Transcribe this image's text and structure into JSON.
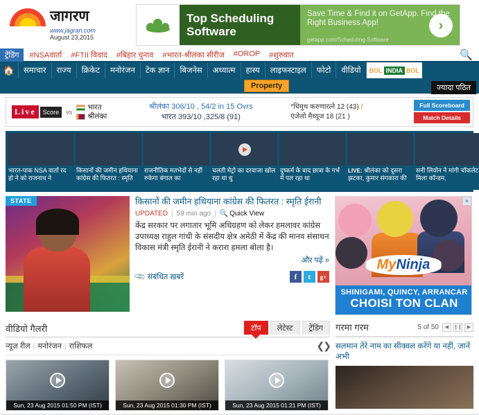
{
  "site": {
    "logo_text": "जागरण",
    "url": "www.jagran.com",
    "date": "August 23,2015"
  },
  "top_ad": {
    "headline": "Top Scheduling Software",
    "body": "Save Time & Find it on GetApp. Find the Right Business App!",
    "display_url": "getapp.com/Scheduling-Software",
    "arrow": "›"
  },
  "trending": {
    "label": "ट्रेंडिंग",
    "items": [
      "#NSAवार्ता",
      "#FTII विवाद",
      "#बिहार चुनाव",
      "#भारत-श्रीलंका सीरीज",
      "#OROP",
      "#शुरुवात"
    ],
    "search_icon": "search-icon"
  },
  "mainnav": {
    "home_icon": "home-icon",
    "items": [
      "समाचार",
      "राज्य",
      "क्रिकेट",
      "मनोरंजन",
      "टेक ज्ञान",
      "बिजनेस",
      "अध्यात्म",
      "हास्य",
      "लाइफस्टाइल",
      "फोटो",
      "वीडियो"
    ],
    "bol": {
      "left": "BOL",
      "mid": "INDIA",
      "right": "BOL"
    },
    "property_label": "Property",
    "more_read_label": "ज्यादा पठित"
  },
  "score": {
    "live_label": "Live",
    "score_label": "Score",
    "vs": "vs",
    "team1": "भारत",
    "team2": "श्रीलंका",
    "line1": "श्रीलंका 306/10 , 54/2 in 15 Ovrs",
    "line2": "भारत 393/10 ,325/8 (91)",
    "batsman1": "*धिमुथ करुणारत्ने 12 (43)",
    "batsman2": "एंजेलो मैथ्यूज 18 (21 )",
    "full_scoreboard": "Full Scoreboard",
    "match_details": "Match Details"
  },
  "thumbnails": [
    {
      "caption": "भारत-पाक NSA वार्ता रद हो ने को राजनाथ ने",
      "video": false,
      "tag": ""
    },
    {
      "caption": "किसानों की जमीन हथियाना कांग्रेस की फितरत : स्मृति",
      "video": false,
      "tag": ""
    },
    {
      "caption": "राजनीतिक मतभेदों से नहीं रुकेगा बंगाल का",
      "video": false,
      "tag": ""
    },
    {
      "caption": "चलती मेट्रो का दरवाजा खोल रहा था धु",
      "video": true,
      "tag": ""
    },
    {
      "caption": "दुष्कर्म के बाद छात्रा के गर्भ में पल रहा था",
      "video": false,
      "tag": ""
    },
    {
      "caption": "श्रीलंका को दूसरा झटका, कुमार संगकारा की",
      "video": false,
      "tag": "LIVE:"
    },
    {
      "caption": "सनी लियोन ने मांगी चॉकलेट, मिला कॉन्डम,",
      "video": false,
      "tag": ""
    }
  ],
  "lead": {
    "state_badge": "STATE"
  },
  "article": {
    "title": "किसानों की जमीन हथियाना कांग्रेस की फितरत : स्मृति ईरानी",
    "updated_label": "UPDATED",
    "time": "59 min ago",
    "quick_view": "Quick View",
    "quick_view_icon": "magnifier-icon",
    "body": "केंद्र सरकार पर लगातार भूमि अधिग्रहण को लेकर हमलावर कांग्रेस उपाध्यक्ष राहुल गांधी के संसदीय क्षेत्र अमेठी में केंद्र की मानव संसाधन विकास मंत्री स्मृति ईरानी ने करारा हमला बोला है।",
    "read_more": "और पढ़ें »",
    "related_label": "संबंधित खबरें",
    "related_icon": "paperclip-icon",
    "social": [
      {
        "name": "facebook-icon",
        "glyph": "f"
      },
      {
        "name": "twitter-icon",
        "glyph": "t"
      },
      {
        "name": "google-plus-icon",
        "glyph": "g+"
      }
    ]
  },
  "side_ad": {
    "brand_my": "My",
    "brand_ninja": "Ninja",
    "line1": "SHINIGAMI, QUINCY, ARRANCAR",
    "line2": "CHOISI TON CLAN",
    "close_icon": "ad-close-icon"
  },
  "video_gallery": {
    "title": "वीडियो गैलरी",
    "tabs": [
      {
        "label": "टॉप",
        "active": true
      },
      {
        "label": "लेटेस्ट",
        "active": false
      },
      {
        "label": "ट्रेंडिंग",
        "active": false
      }
    ],
    "sublinks": [
      "न्यूज़ रील",
      "मनोरंजन",
      "राशिफल"
    ],
    "prev_icon": "chevron-left-icon",
    "next_icon": "chevron-right-icon",
    "cards": [
      {
        "timestamp": "Sun, 23 Aug 2015 01:50 PM (IST)"
      },
      {
        "timestamp": "Sun, 23 Aug 2015 01:30 PM (IST)"
      },
      {
        "timestamp": "Sun, 23 Aug 2015 01:21 PM (IST)"
      }
    ]
  },
  "hot_box": {
    "title": "गरमा गरम",
    "counter": "5 of 50",
    "prev_icon": "prev-icon",
    "pause_icon": "pause-icon",
    "next_icon": "next-icon",
    "headline": "सलमान तेरे नाम का सीक्वल करेंगे या नहीं, जानें अभी"
  },
  "colors": {
    "nav_blue": "#0d5475",
    "accent_red": "#c0392b",
    "link_blue": "#0c5a86",
    "orange": "#f7a32b"
  }
}
